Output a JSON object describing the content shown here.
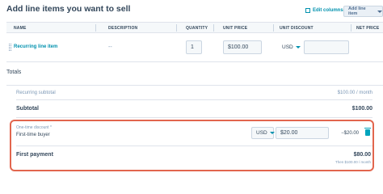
{
  "header": {
    "title": "Add line items you want to sell",
    "edit_columns": "Edit columns",
    "add_line_item": "Add line item"
  },
  "table": {
    "columns": [
      "NAME",
      "DESCRIPTION",
      "QUANTITY",
      "UNIT PRICE",
      "UNIT DISCOUNT",
      "NET PRICE"
    ],
    "rows": [
      {
        "name": "Recurring line item",
        "description": "--",
        "quantity": "1",
        "unit_price": "$100.00",
        "discount_currency": "USD",
        "discount_value": ""
      }
    ]
  },
  "totals": {
    "label": "Totals",
    "recurring_subtotal_label": "Recurring subtotal",
    "recurring_subtotal_value": "$100.00 / month",
    "subtotal_label": "Subtotal",
    "subtotal_value": "$100.00",
    "one_time_discount": {
      "label": "One-time discount *",
      "name": "First-time buyer",
      "currency": "USD",
      "value": "$20.00",
      "amount": "−$20.00"
    },
    "first_payment_label": "First payment",
    "first_payment_value": "$80.00",
    "then_text": "Then $100.00 / month"
  },
  "colors": {
    "accent": "#0091ae",
    "highlight_border": "#e2664e",
    "text": "#33475b"
  }
}
